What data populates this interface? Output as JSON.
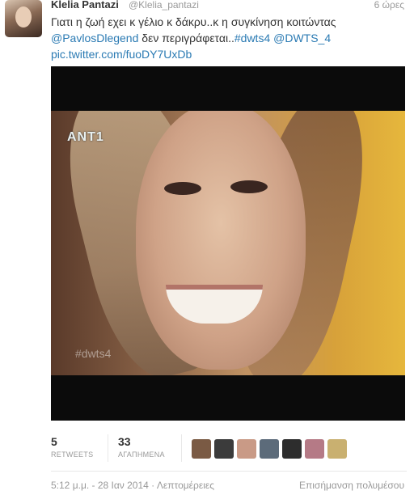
{
  "tweet": {
    "author_name": "Klelia Pantazi",
    "handle": "@Klelia_pantazi",
    "time_ago": "6 ώρες",
    "text_line1": "Γιατι η ζωή εχει κ γέλιο κ δάκρυ..κ η συγκίνηση κοιτώντας",
    "mention": "@PavlosDlegend",
    "text_mid": " δεν περιγράφεται..",
    "hashtag": "#dwts4",
    "mention2": "@DWTS_4",
    "pic_link": "pic.twitter.com/fuoDY7UxDb"
  },
  "media": {
    "channel_logo": "ANT1",
    "watermark": "#dwts4"
  },
  "stats": {
    "retweets_count": "5",
    "retweets_label": "RETWEETS",
    "favorites_count": "33",
    "favorites_label": "ΑΓΑΠΗΜΕΝΑ"
  },
  "favoriters": [
    {
      "color": "#7a5a44"
    },
    {
      "color": "#3b3b3b"
    },
    {
      "color": "#c99a86"
    },
    {
      "color": "#5c6b7a"
    },
    {
      "color": "#2d2d2d"
    },
    {
      "color": "#b57a86"
    },
    {
      "color": "#c9b070"
    }
  ],
  "footer": {
    "timestamp": "5:12 μ.μ. - 28 Ιαν 2014",
    "separator": " · ",
    "details_link": "Λεπτομέρειες",
    "flag_media": "Επισήμανση πολυμέσου"
  }
}
